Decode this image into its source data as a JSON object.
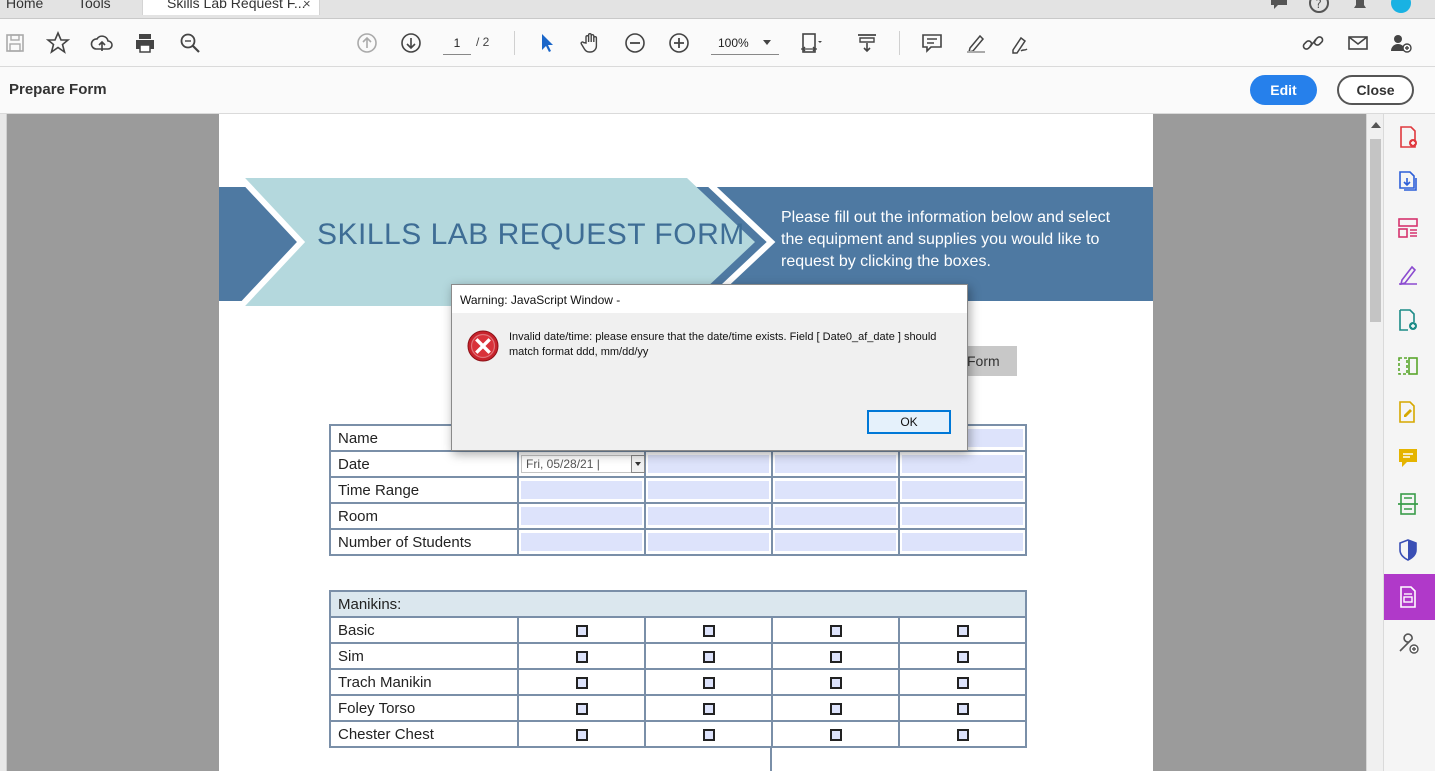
{
  "tabs": {
    "home": "Home",
    "tools": "Tools",
    "document": "Skills Lab Request F...",
    "close_symbol": "×"
  },
  "toolbar": {
    "page_current": "1",
    "page_total": "/ 2",
    "zoom": "100%"
  },
  "formbar": {
    "title": "Prepare Form",
    "edit_label": "Edit",
    "close_label": "Close"
  },
  "document": {
    "banner_title": "SKILLS LAB REQUEST FORM",
    "banner_text": "Please fill out the information below and select the equipment and supplies you would like to request by clicking the boxes.",
    "submit_partial": "Form",
    "info_rows": [
      "Name",
      "Date",
      "Time Range",
      "Room",
      "Number of Students"
    ],
    "date_value": "Fri, 05/28/21 |",
    "manikins_header": "Manikins:",
    "manikin_rows": [
      "Basic",
      "Sim",
      "Trach Manikin",
      "Foley Torso",
      "Chester Chest"
    ]
  },
  "dialog": {
    "title": "Warning: JavaScript Window -",
    "message": "Invalid date/time: please ensure that the date/time exists. Field [ Date0_af_date ] should match format ddd, mm/dd/yy",
    "ok_label": "OK"
  },
  "colors": {
    "accent": "#2680eb",
    "banner": "#4e79a2",
    "banner_arrow": "#b4d8dd",
    "field_fill": "#dde3fb",
    "active_tool": "#b039c9"
  }
}
